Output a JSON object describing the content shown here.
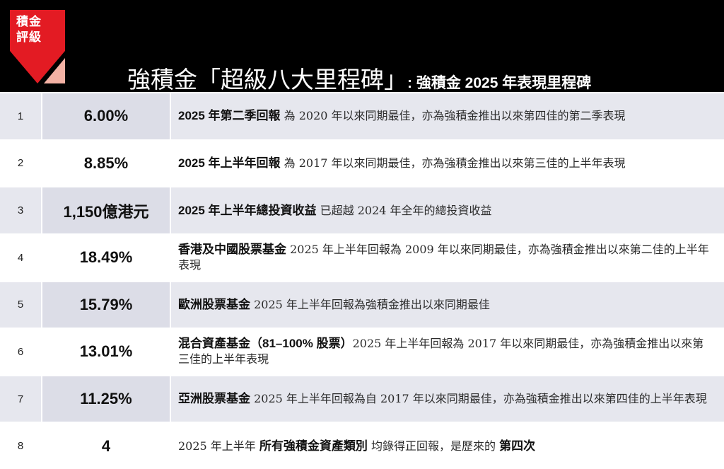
{
  "badge": {
    "line1": "積金",
    "line2": "評級"
  },
  "colors": {
    "badge_red": "#e31b23",
    "badge_pink": "#f3b1a4",
    "row_shade": "#e6e7ee",
    "header_bg": "#000000"
  },
  "title": {
    "main": "強積金「超級八大里程碑」",
    "sub": ": 強積金 2025 年表現里程碑"
  },
  "rows": [
    {
      "num": "1",
      "value": "6.00%",
      "lead": "2025 年第二季回報",
      "desc": " 為 2020 年以來同期最佳，亦為強積金推出以來第四佳的第二季表現",
      "tail": ""
    },
    {
      "num": "2",
      "value": "8.85%",
      "lead": "2025 年上半年回報",
      "desc": " 為 2017 年以來同期最佳，亦為強積金推出以來第三佳的上半年表現",
      "tail": ""
    },
    {
      "num": "3",
      "value": "1,150億港元",
      "lead": "2025 年上半年總投資收益",
      "desc": " 已超越 2024 年全年的總投資收益",
      "tail": ""
    },
    {
      "num": "4",
      "value": "18.49%",
      "lead": "香港及中國股票基金",
      "desc": " 2025 年上半年回報為 2009 年以來同期最佳，亦為強積金推出以來第二佳的上半年表現",
      "tail": ""
    },
    {
      "num": "5",
      "value": "15.79%",
      "lead": "歐洲股票基金",
      "desc": " 2025 年上半年回報為強積金推出以來同期最佳",
      "tail": ""
    },
    {
      "num": "6",
      "value": "13.01%",
      "lead": "混合資產基金（81–100% 股票）",
      "desc": "2025 年上半年回報為 2017 年以來同期最佳，亦為強積金推出以來第三佳的上半年表現",
      "tail": ""
    },
    {
      "num": "7",
      "value": "11.25%",
      "lead": "亞洲股票基金",
      "desc": " 2025 年上半年回報為自 2017 年以來同期最佳，亦為強積金推出以來第四佳的上半年表現",
      "tail": ""
    },
    {
      "num": "8",
      "value": "4",
      "lead": "",
      "desc": "2025 年上半年 ",
      "mid": "所有強積金資產類別",
      "desc2": " 均錄得正回報，是歷來的 ",
      "tail": "第四次"
    }
  ]
}
